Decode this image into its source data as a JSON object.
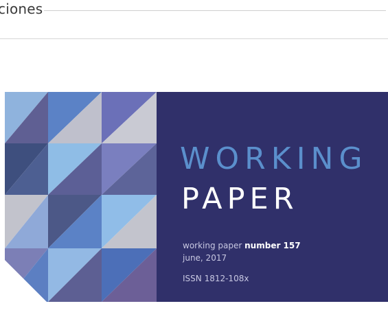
{
  "section": {
    "title": "ciones"
  },
  "cover": {
    "title_line1": "WORKING",
    "title_line2": "PAPER",
    "paper_prefix": "working paper ",
    "paper_number": "number 157",
    "date": "june, 2017",
    "issn": "ISSN 1812-108x",
    "colors": {
      "panel": "#30306a",
      "accent_blue": "#5b8fcc"
    }
  }
}
